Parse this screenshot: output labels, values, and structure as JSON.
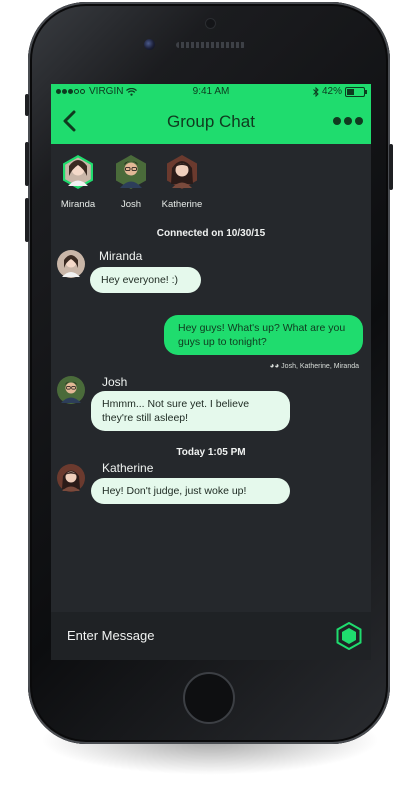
{
  "status_bar": {
    "carrier": "VIRGIN",
    "time": "9:41 AM",
    "battery": "42%",
    "battery_level": 0.42
  },
  "header": {
    "back_icon": "chevron-left-icon",
    "title": "Group Chat",
    "more_icon": "more-dots-icon"
  },
  "participants": [
    {
      "name": "Miranda",
      "active": true
    },
    {
      "name": "Josh",
      "active": false
    },
    {
      "name": "Katherine",
      "active": false
    }
  ],
  "chat": {
    "connected_prefix": "Connected on",
    "connected_date": "10/30/15",
    "messages": [
      {
        "sender": "Miranda",
        "text": "Hey everyone! :)",
        "direction": "in"
      },
      {
        "sender": "",
        "text": "Hey guys! What's up? What are you guys up to tonight?",
        "direction": "out",
        "seen_by": "Josh, Katherine, Miranda"
      },
      {
        "sender": "Josh",
        "text": "Hmmm... Not sure yet. I believe they're still asleep!",
        "direction": "in"
      },
      {
        "sender": "Katherine",
        "text": "Hey! Don't judge, just woke up!",
        "direction": "in"
      }
    ],
    "timestamp": "Today 1:05 PM"
  },
  "input": {
    "placeholder": "Enter Message",
    "send_icon": "hexagon-send-icon"
  },
  "colors": {
    "accent": "#1fdc6e",
    "background": "#25282c",
    "bubble_incoming": "#e5f9ec",
    "header_text": "#103a1f"
  }
}
